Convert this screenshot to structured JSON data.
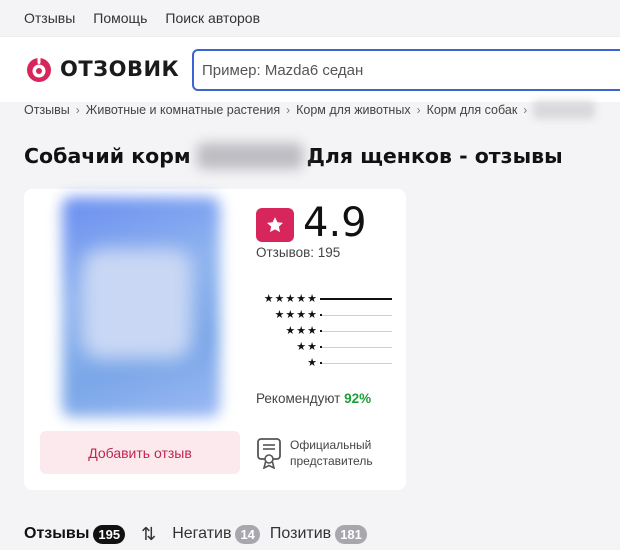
{
  "topnav": {
    "items": [
      "Отзывы",
      "Помощь",
      "Поиск авторов"
    ]
  },
  "header": {
    "logo_text": "ОТЗОВИК",
    "logo_color": "#d6265b",
    "search_placeholder": "Пример: Mazda6 седан",
    "search_border_color": "#3d63d7"
  },
  "breadcrumb": {
    "items": [
      "Отзывы",
      "Животные и комнатные растения",
      "Корм для животных",
      "Корм для собак"
    ],
    "separator": "›"
  },
  "page": {
    "title_prefix": "Собачий корм",
    "title_suffix": "Для щенков - отзывы"
  },
  "product": {
    "rating": "4.9",
    "reviews_label": "Отзывов: 195",
    "distribution": [
      {
        "stars": "★★★★★",
        "fraction": 1.0
      },
      {
        "stars": "★★★★",
        "fraction": 0.02
      },
      {
        "stars": "★★★",
        "fraction": 0.02
      },
      {
        "stars": "★★",
        "fraction": 0.02
      },
      {
        "stars": "★",
        "fraction": 0.02
      }
    ],
    "recommend_label": "Рекомендуют",
    "recommend_pct": "92%",
    "add_review_label": "Добавить отзыв",
    "official_label": "Официальный представитель",
    "accent_color": "#d6265b",
    "recommend_color": "#1f9e3a"
  },
  "tabs": [
    {
      "label": "Отзывы",
      "count": "195",
      "active": true
    },
    {
      "label": "Негатив",
      "count": "14",
      "active": false
    },
    {
      "label": "Позитив",
      "count": "181",
      "active": false
    }
  ],
  "icons": {
    "logo": "logo-icon",
    "rating_star": "star-icon",
    "sort": "sort-arrows-icon",
    "official": "certificate-icon"
  }
}
